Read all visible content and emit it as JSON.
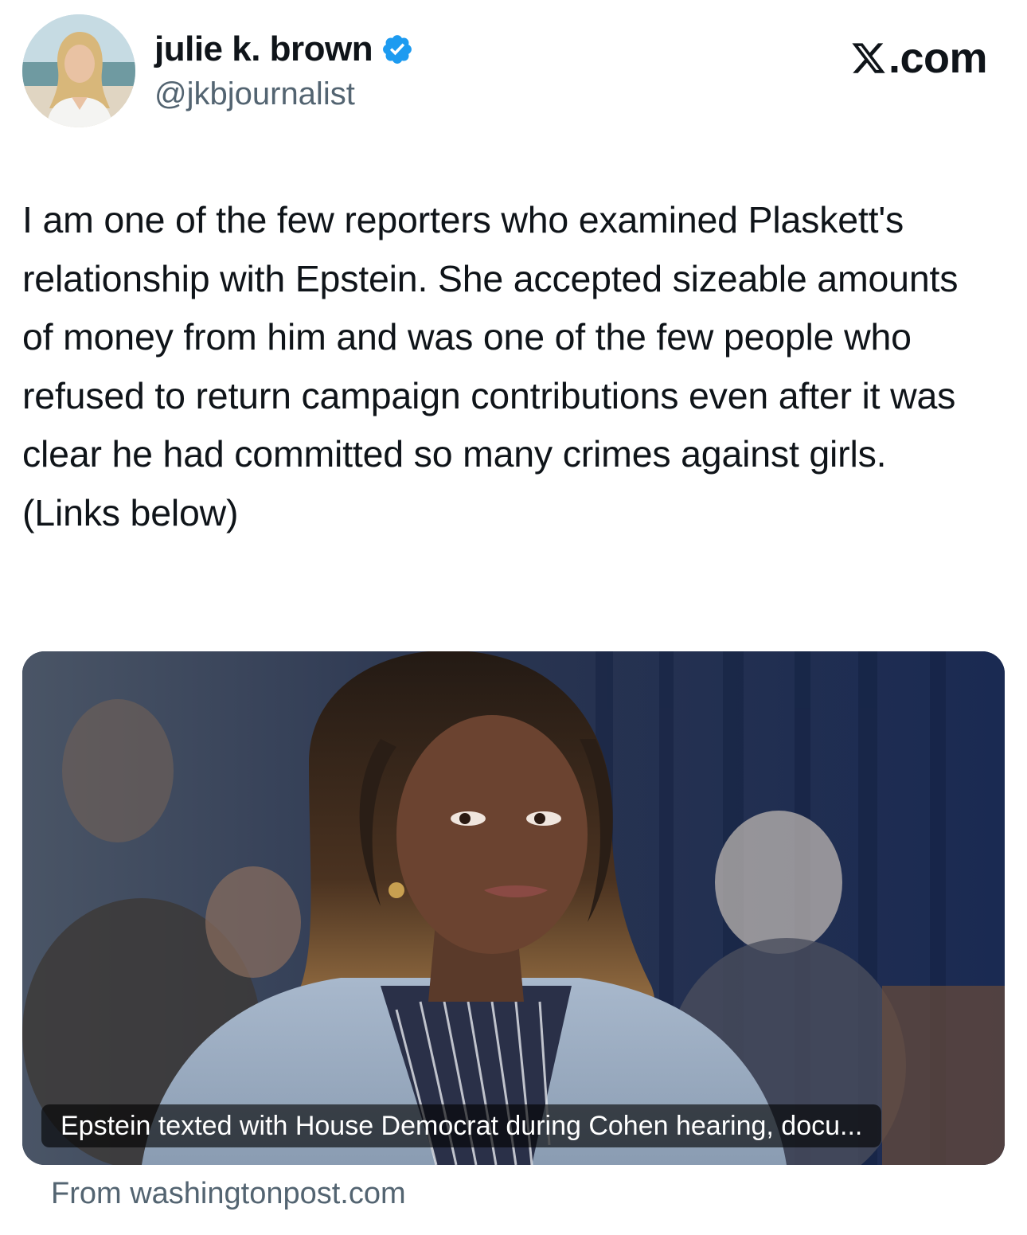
{
  "author": {
    "display_name": "julie k. brown",
    "handle": "@jkbjournalist",
    "verified": true,
    "avatar_icon": "profile-photo"
  },
  "brand": {
    "label": ".com",
    "logo_icon": "x-logo-icon"
  },
  "tweet": {
    "text": "I am one of the few reporters who examined Plaskett's relationship with Epstein. She accepted sizeable amounts of money from him and was one of the few people who refused to return campaign contributions even after it was clear he had committed so many crimes against girls. (Links below)"
  },
  "link_card": {
    "title": "Epstein texted with House Democrat during Cohen hearing, docu...",
    "source": "From washingtonpost.com"
  },
  "colors": {
    "text_primary": "#0f1419",
    "text_secondary": "#536471",
    "verified_blue": "#1d9bf0"
  }
}
